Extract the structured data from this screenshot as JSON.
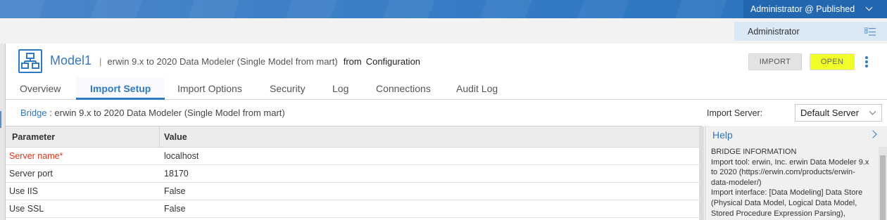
{
  "topbar": {
    "user_menu_label": "Administrator @ Published"
  },
  "subbar": {
    "admin_label": "Administrator"
  },
  "model": {
    "title": "Model1",
    "separator": "|",
    "description": "erwin 9.x to 2020 Data Modeler (Single Model from mart)",
    "from_label": "from",
    "configuration": "Configuration"
  },
  "actions": {
    "import_label": "IMPORT",
    "open_label": "OPEN"
  },
  "tabs": [
    {
      "label": "Overview"
    },
    {
      "label": "Import Setup"
    },
    {
      "label": "Import Options"
    },
    {
      "label": "Security"
    },
    {
      "label": "Log"
    },
    {
      "label": "Connections"
    },
    {
      "label": "Audit Log"
    }
  ],
  "active_tab": "Import Setup",
  "bridge": {
    "label": "Bridge",
    "value": ": erwin 9.x to 2020 Data Modeler (Single Model from mart)"
  },
  "import_server": {
    "label": "Import Server:",
    "selected": "Default Server"
  },
  "grid": {
    "headers": {
      "parameter": "Parameter",
      "value": "Value"
    },
    "rows": [
      {
        "parameter": "Server name*",
        "value": "localhost",
        "required": true
      },
      {
        "parameter": "Server port",
        "value": "18170",
        "required": false
      },
      {
        "parameter": "Use IIS",
        "value": "False",
        "required": false
      },
      {
        "parameter": "Use SSL",
        "value": "False",
        "required": false
      }
    ]
  },
  "help": {
    "title": "Help",
    "lines": [
      "BRIDGE INFORMATION",
      "Import tool: erwin, Inc. erwin Data Modeler 9.x",
      "to 2020 (https://erwin.com/products/erwin-",
      "data-modeler/)",
      "Import interface: [Data Modeling] Data Store",
      "(Physical Data Model, Logical Data Model,",
      "Stored Procedure Expression Parsing),"
    ]
  },
  "colors": {
    "accent": "#2f78c2",
    "required": "#d9361b",
    "highlight": "#f0ff2a"
  }
}
